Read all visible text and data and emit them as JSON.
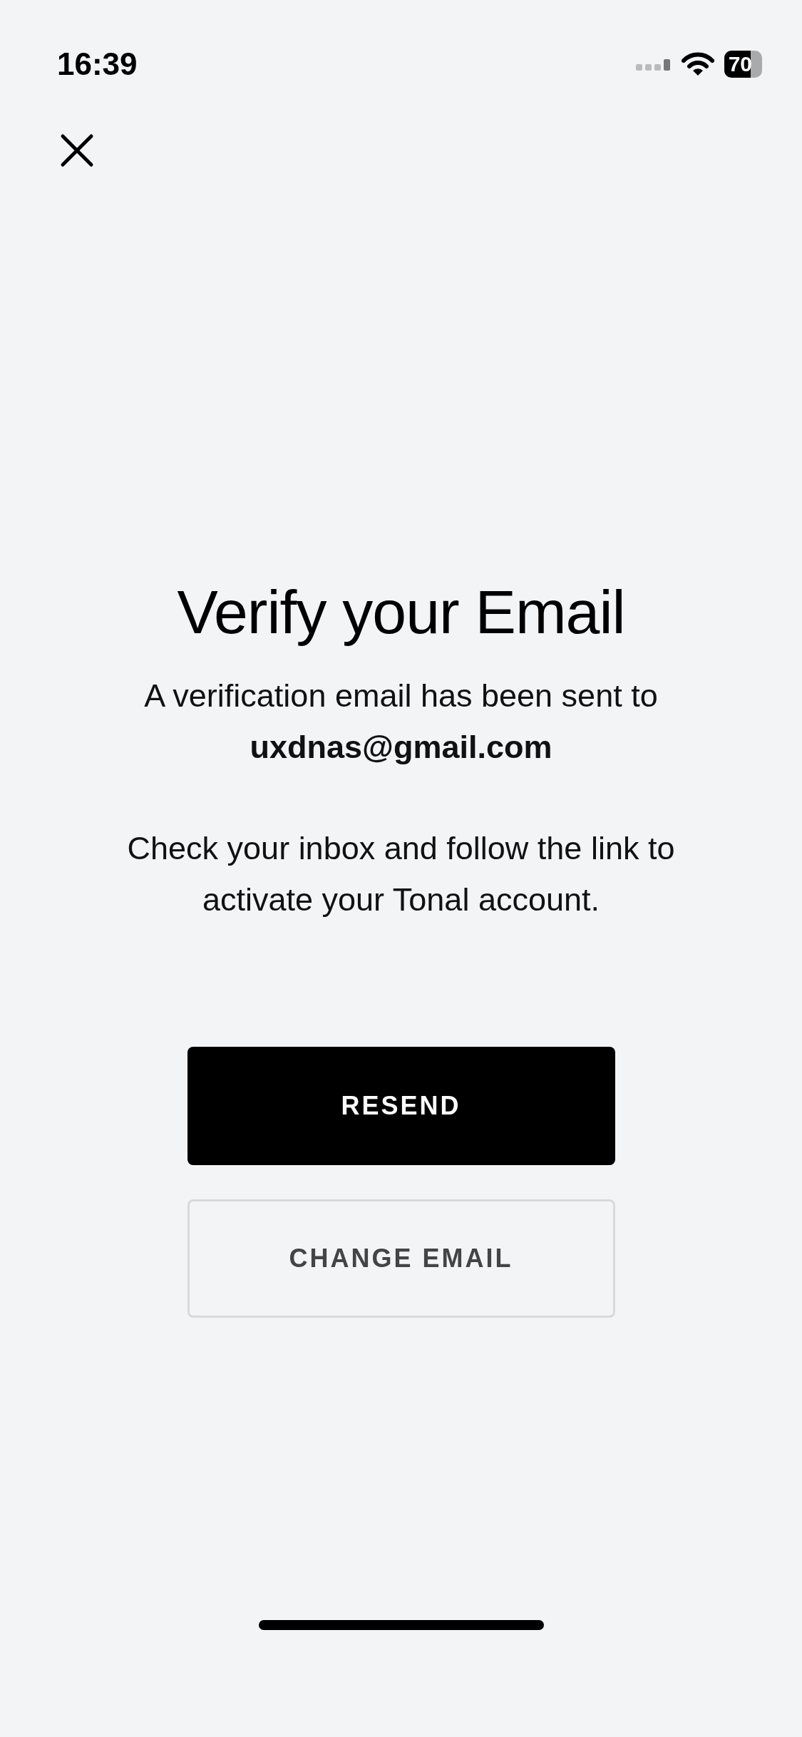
{
  "status_bar": {
    "time": "16:39",
    "battery": "70"
  },
  "title": "Verify your Email",
  "message": "A verification email has been sent to **uxdnas@gmail.com**",
  "instruction": "Check your inbox and follow the link to activate your Tonal account.",
  "buttons": [
    {
      "label": "RESEND",
      "kind": "primary"
    },
    {
      "label": "CHANGE EMAIL",
      "kind": "secondary"
    }
  ]
}
